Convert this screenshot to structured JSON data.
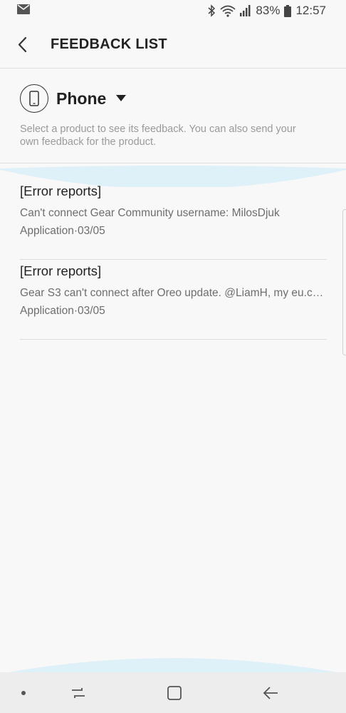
{
  "status_bar": {
    "battery_percent": "83%",
    "time": "12:57",
    "left_icons": [
      "mail-icon"
    ],
    "right_icons": [
      "bluetooth-icon",
      "wifi-icon",
      "signal-icon",
      "battery-icon"
    ]
  },
  "header": {
    "title": "FEEDBACK LIST",
    "back_icon": "back-arrow-icon"
  },
  "product": {
    "selected": "Phone",
    "icon": "phone-icon",
    "helper_text": "Select a product to see its feedback. You can also send your own feedback for the product."
  },
  "feedback_items": [
    {
      "category": "[Error reports]",
      "summary": "Can't connect Gear Community username: MilosDjuk",
      "meta": "Application·03/05"
    },
    {
      "category": "[Error reports]",
      "summary": "Gear S3 can't connect after Oreo update. @LiamH, my eu.com...",
      "meta": "Application·03/05"
    }
  ],
  "nav_bar": {
    "buttons": [
      "dot-indicator-icon",
      "recents-icon",
      "home-icon",
      "back-icon"
    ]
  },
  "colors": {
    "background": "#f8f8f8",
    "wave_accent": "#dff1f8",
    "nav_background": "#ededed",
    "text_primary": "#222222",
    "text_secondary": "#6e6e6e"
  }
}
